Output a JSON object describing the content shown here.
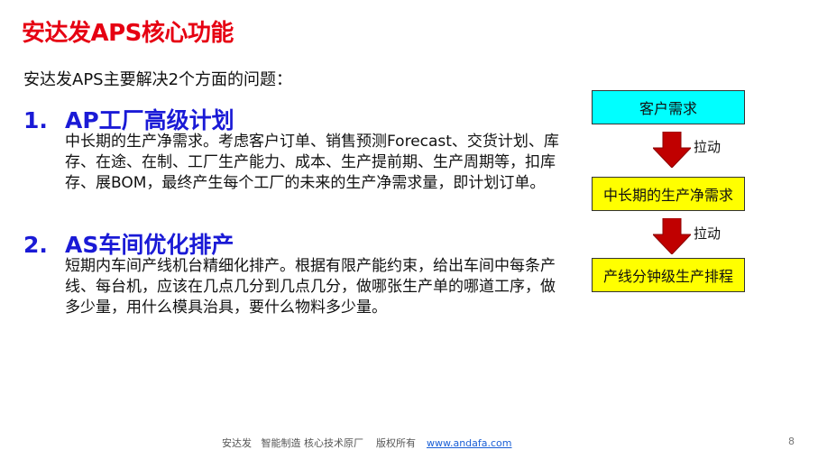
{
  "title": "安达发APS核心功能",
  "intro": "安达发APS主要解决2个方面的问题：",
  "sections": [
    {
      "number": "1.",
      "heading": "AP工厂高级计划",
      "desc": "中长期的生产净需求。考虑客户订单、销售预测Forecast、交货计划、库存、在途、在制、工厂生产能力、成本、生产提前期、生产周期等，扣库存、展BOM，最终产生每个工厂的未来的生产净需求量，即计划订单。"
    },
    {
      "number": "2.",
      "heading": "AS车间优化排产",
      "desc": "短期内车间产线机台精细化排产。根据有限产能约束，给出车间中每条产线、每台机，应该在几点几分到几点几分，做哪张生产单的哪道工序，做多少量，用什么模具治具，要什么物料多少量。"
    }
  ],
  "flow": {
    "boxes": [
      "客户需求",
      "中长期的生产净需求",
      "产线分钟级生产排程"
    ],
    "arrow_label": "拉动",
    "colors": {
      "first": "#00ffff",
      "others": "#ffff00",
      "arrow": "#c00000"
    }
  },
  "footer": {
    "text": "安达发   智能制造 核心技术原厂    版权所有",
    "link": "www.andafa.com"
  },
  "page_number": "8",
  "colors": {
    "title": "#e60012",
    "heading": "#1a1ad6"
  }
}
